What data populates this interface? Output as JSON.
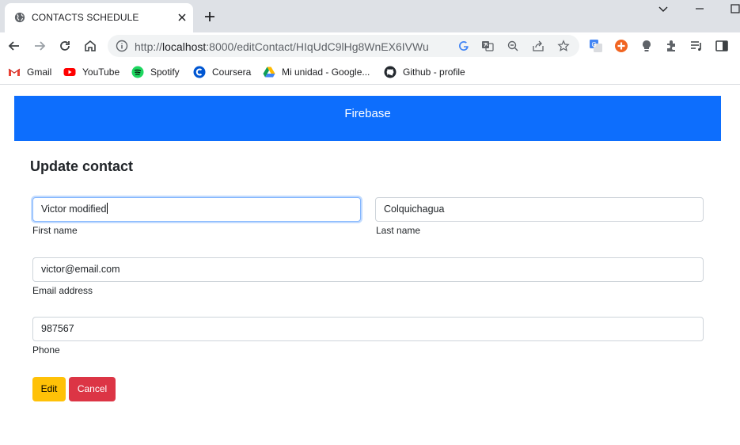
{
  "browser": {
    "tab_title": "CONTACTS SCHEDULE",
    "url_scheme": "http://",
    "url_host": "localhost",
    "url_rest": ":8000/editContact/HIqUdC9lHg8WnEX6IVWu",
    "bookmarks": [
      "Gmail",
      "YouTube",
      "Spotify",
      "Coursera",
      "Mi unidad - Google...",
      "Github - profile"
    ]
  },
  "app": {
    "brand": "Firebase",
    "heading": "Update contact"
  },
  "form": {
    "first_name_value": "Victor modified",
    "first_name_label": "First name",
    "last_name_value": "Colquichagua",
    "last_name_label": "Last name",
    "email_value": "victor@email.com",
    "email_label": "Email address",
    "phone_value": "987567",
    "phone_label": "Phone",
    "edit_label": "Edit",
    "cancel_label": "Cancel"
  },
  "colors": {
    "navbar": "#0d6efd",
    "edit_button": "#ffc107",
    "cancel_button": "#dc3545"
  }
}
